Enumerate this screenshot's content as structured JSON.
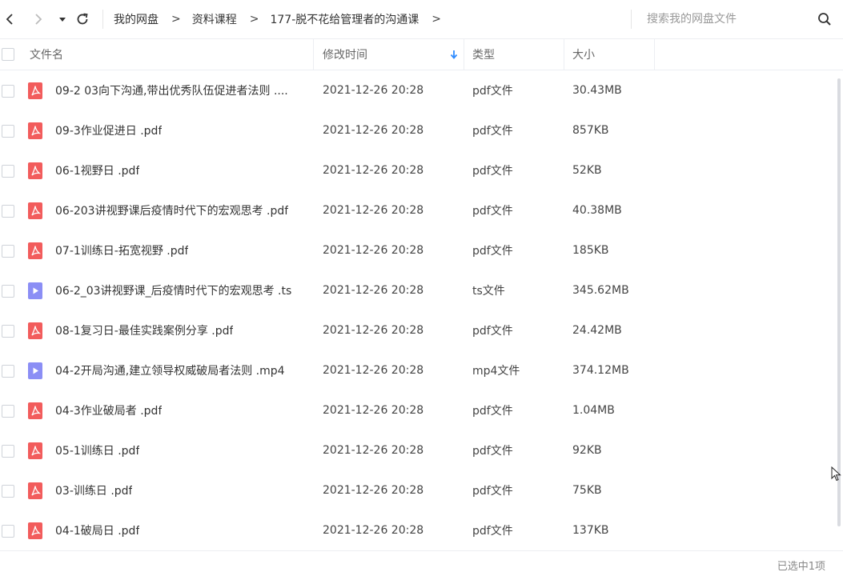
{
  "toolbar": {
    "breadcrumb": [
      "我的网盘",
      "资料课程",
      "177-脱不花给管理者的沟通课"
    ],
    "arrow": ">",
    "search_placeholder": "搜索我的网盘文件"
  },
  "columns": {
    "name": "文件名",
    "modified": "修改时间",
    "type": "类型",
    "size": "大小"
  },
  "files": [
    {
      "name": "09-2 03向下沟通,带出优秀队伍促进者法则 ....",
      "modified": "2021-12-26 20:28",
      "type": "pdf文件",
      "size": "30.43MB",
      "icon": "pdf-icon"
    },
    {
      "name": "09-3作业促进日 .pdf",
      "modified": "2021-12-26 20:28",
      "type": "pdf文件",
      "size": "857KB",
      "icon": "pdf-icon"
    },
    {
      "name": "06-1视野日 .pdf",
      "modified": "2021-12-26 20:28",
      "type": "pdf文件",
      "size": "52KB",
      "icon": "pdf-icon"
    },
    {
      "name": "06-203讲视野课后疫情时代下的宏观思考 .pdf",
      "modified": "2021-12-26 20:28",
      "type": "pdf文件",
      "size": "40.38MB",
      "icon": "pdf-icon"
    },
    {
      "name": "07-1训练日-拓宽视野 .pdf",
      "modified": "2021-12-26 20:28",
      "type": "pdf文件",
      "size": "185KB",
      "icon": "pdf-icon"
    },
    {
      "name": "06-2_03讲视野课_后疫情时代下的宏观思考 .ts",
      "modified": "2021-12-26 20:28",
      "type": "ts文件",
      "size": "345.62MB",
      "icon": "video-icon"
    },
    {
      "name": "08-1复习日-最佳实践案例分享 .pdf",
      "modified": "2021-12-26 20:28",
      "type": "pdf文件",
      "size": "24.42MB",
      "icon": "pdf-icon"
    },
    {
      "name": "04-2开局沟通,建立领导权威破局者法则 .mp4",
      "modified": "2021-12-26 20:28",
      "type": "mp4文件",
      "size": "374.12MB",
      "icon": "video-icon"
    },
    {
      "name": "04-3作业破局者 .pdf",
      "modified": "2021-12-26 20:28",
      "type": "pdf文件",
      "size": "1.04MB",
      "icon": "pdf-icon"
    },
    {
      "name": "05-1训练日 .pdf",
      "modified": "2021-12-26 20:28",
      "type": "pdf文件",
      "size": "92KB",
      "icon": "pdf-icon"
    },
    {
      "name": "03-训练日 .pdf",
      "modified": "2021-12-26 20:28",
      "type": "pdf文件",
      "size": "75KB",
      "icon": "pdf-icon"
    },
    {
      "name": "04-1破局日 .pdf",
      "modified": "2021-12-26 20:28",
      "type": "pdf文件",
      "size": "137KB",
      "icon": "pdf-icon"
    }
  ],
  "status": {
    "selection": "已选中1项"
  },
  "colors": {
    "pdf": "#f25c5c",
    "video": "#8b8ef5",
    "sort_arrow": "#2f8cff"
  }
}
